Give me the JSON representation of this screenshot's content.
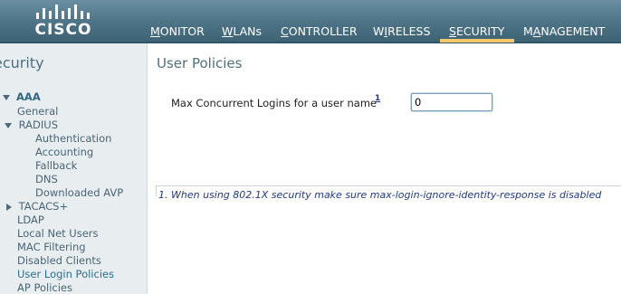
{
  "header": {
    "logo_text": "CISCO",
    "nav": [
      {
        "label_underline": "M",
        "label_rest": "ONITOR"
      },
      {
        "label_underline": "W",
        "label_rest": "LANs"
      },
      {
        "label_underline": "C",
        "label_rest": "ONTROLLER"
      },
      {
        "label_pre": "W",
        "label_underline": "I",
        "label_rest": "RELESS"
      },
      {
        "label_underline": "S",
        "label_rest": "ECURITY"
      },
      {
        "label_pre": "M",
        "label_underline": "A",
        "label_rest": "NAGEMENT"
      }
    ],
    "active_nav": "SECURITY",
    "colors": {
      "bar": "#4d7386",
      "active_indicator": "#f6c86a"
    }
  },
  "sidebar": {
    "title": "ecurity",
    "aaa": "AAA",
    "general": "General",
    "radius": "RADIUS",
    "authentication": "Authentication",
    "accounting": "Accounting",
    "fallback": "Fallback",
    "dns": "DNS",
    "downloaded_avp": "Downloaded AVP",
    "tacacs": "TACACS+",
    "ldap": "LDAP",
    "local_net_users": "Local Net Users",
    "mac_filtering": "MAC Filtering",
    "disabled_clients": "Disabled Clients",
    "user_login_policies": "User Login Policies",
    "ap_policies": "AP Policies"
  },
  "main": {
    "title": "User Policies",
    "field_label": "Max Concurrent Logins for a user name",
    "field_footnote_ref": "1",
    "field_value": "0",
    "footnote": "1. When using 802.1X security make sure max-login-ignore-identity-response is disabled"
  }
}
